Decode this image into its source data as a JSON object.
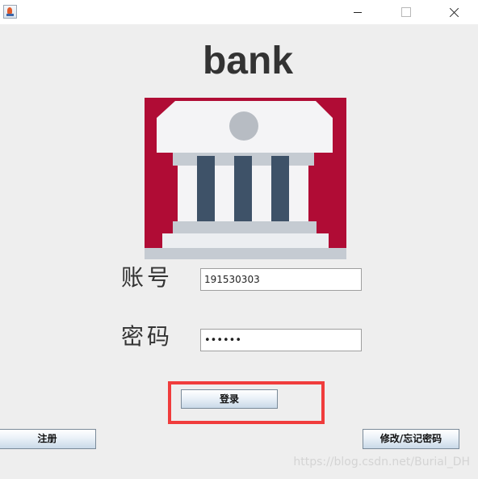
{
  "window": {
    "app_icon": "java-icon",
    "controls": [
      "minimize-icon",
      "maximize-icon",
      "close-icon"
    ]
  },
  "app": {
    "title": "bank",
    "logo": "bank-building-icon"
  },
  "form": {
    "account_label": "账号",
    "account_value": "191530303",
    "password_label": "密码",
    "password_mask": "••••••"
  },
  "buttons": {
    "login": "登录",
    "register": "注册",
    "modify_password": "修改/忘记密码"
  },
  "highlight": {
    "target": "login-button",
    "color": "#f03c3c"
  },
  "watermark": "https://blog.csdn.net/Burial_DH",
  "colors": {
    "logo_background": "#b00c35",
    "logo_building": "#f4f4f6",
    "logo_columns": "#3e5268",
    "window_background": "#eeeeee"
  }
}
